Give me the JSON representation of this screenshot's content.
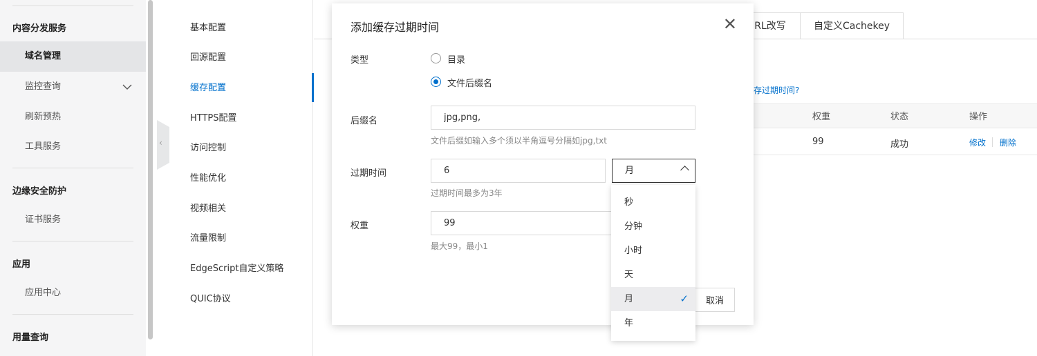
{
  "sidebar": {
    "sections": [
      {
        "title": "内容分发服务",
        "items": [
          "域名管理",
          "监控查询",
          "刷新预热",
          "工具服务"
        ]
      },
      {
        "title": "边缘安全防护",
        "items": [
          "证书服务"
        ]
      },
      {
        "title": "应用",
        "items": [
          "应用中心"
        ]
      },
      {
        "title": "用量查询",
        "items": []
      }
    ],
    "active_item": "域名管理",
    "collapse_glyph": "‹"
  },
  "subnav": {
    "items": [
      "基本配置",
      "回源配置",
      "缓存配置",
      "HTTPS配置",
      "访问控制",
      "性能优化",
      "视频相关",
      "流量限制",
      "EdgeScript自定义策略",
      "QUIC协议"
    ],
    "active_item": "缓存配置"
  },
  "background": {
    "tabs": [
      "RL改写",
      "自定义Cachekey"
    ],
    "help_link": "存过期时间?",
    "table": {
      "headers": [
        "权重",
        "状态",
        "操作"
      ],
      "row": {
        "weight": "99",
        "status": "成功",
        "actions": [
          "修改",
          "删除"
        ]
      }
    }
  },
  "modal": {
    "title": "添加缓存过期时间",
    "close_glyph": "✕",
    "type_label": "类型",
    "type_options": [
      "目录",
      "文件后缀名"
    ],
    "type_selected": "文件后缀名",
    "suffix_label": "后缀名",
    "suffix_value": "jpg,png,",
    "suffix_hint": "文件后缀如输入多个须以半角逗号分隔如jpg,txt",
    "expire_label": "过期时间",
    "expire_value": "6",
    "expire_unit": "月",
    "expire_hint": "过期时间最多为3年",
    "weight_label": "权重",
    "weight_value": "99",
    "weight_hint": "最大99，最小1",
    "cancel_label": "取消"
  },
  "dropdown": {
    "options": [
      "秒",
      "分钟",
      "小时",
      "天",
      "月",
      "年"
    ],
    "selected": "月",
    "check_glyph": "✓"
  },
  "colors": {
    "accent": "#0070cc",
    "sidebar_bg": "#f5f5f6",
    "sidebar_active": "#e4e5e7"
  }
}
